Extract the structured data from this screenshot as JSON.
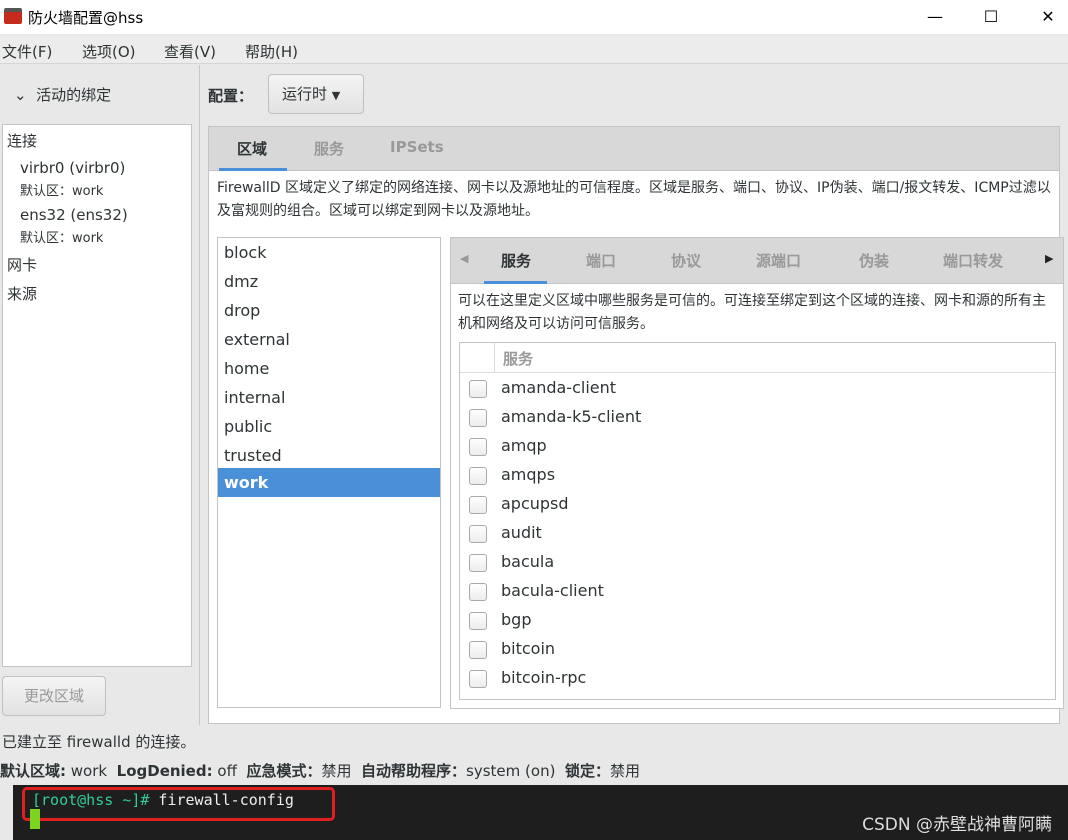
{
  "window": {
    "title": "防火墙配置@hss",
    "minimize": "—",
    "maximize": "☐",
    "close": "✕"
  },
  "menu": [
    "文件(F)",
    "选项(O)",
    "查看(V)",
    "帮助(H)"
  ],
  "left": {
    "header": "活动的绑定",
    "connections_label": "连接",
    "connections": [
      {
        "name": "virbr0 (virbr0)",
        "zone": "默认区：work"
      },
      {
        "name": "ens32 (ens32)",
        "zone": "默认区：work"
      }
    ],
    "interfaces_label": "网卡",
    "sources_label": "来源",
    "change_zone_button": "更改区域"
  },
  "config": {
    "label": "配置：",
    "value": "运行时"
  },
  "tabs": [
    "区域",
    "服务",
    "IPSets"
  ],
  "active_tab": 0,
  "zone_description": "FirewallD 区域定义了绑定的网络连接、网卡以及源地址的可信程度。区域是服务、端口、协议、IP伪装、端口/报文转发、ICMP过滤以及富规则的组合。区域可以绑定到网卡以及源地址。",
  "zones": [
    "block",
    "dmz",
    "drop",
    "external",
    "home",
    "internal",
    "public",
    "trusted",
    "work"
  ],
  "selected_zone": "work",
  "inner_tabs": [
    "服务",
    "端口",
    "协议",
    "源端口",
    "伪装",
    "端口转发"
  ],
  "services_description": "可以在这里定义区域中哪些服务是可信的。可连接至绑定到这个区域的连接、网卡和源的所有主机和网络及可以访问可信服务。",
  "services_header": "服务",
  "services": [
    "amanda-client",
    "amanda-k5-client",
    "amqp",
    "amqps",
    "apcupsd",
    "audit",
    "bacula",
    "bacula-client",
    "bgp",
    "bitcoin",
    "bitcoin-rpc"
  ],
  "status": {
    "connection": "已建立至 firewalld 的连接。",
    "default_zone_label": "默认区域:",
    "default_zone": "work",
    "logdenied_label": "LogDenied:",
    "logdenied": "off",
    "panic_label": "应急模式：",
    "panic": "禁用",
    "helper_label": "自动帮助程序：",
    "helper": "system (on)",
    "lock_label": "锁定：",
    "lock": "禁用"
  },
  "terminal": {
    "prompt": "[root@hss ~]#",
    "command": " firewall-config",
    "watermark": "CSDN @赤壁战神曹阿瞒"
  },
  "colors": {
    "accent": "#4a90d9",
    "highlight_box": "#e02020",
    "prompt": "#33cc99"
  }
}
